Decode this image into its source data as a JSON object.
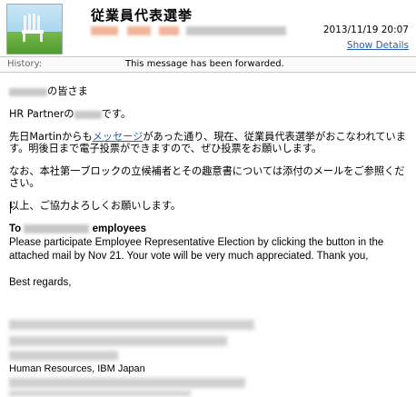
{
  "header": {
    "subject": "従業員代表選挙",
    "date": "2013/11/19 20:07",
    "show_details": "Show Details"
  },
  "history": {
    "label": "History:",
    "text": "This message has been forwarded."
  },
  "body_jp": {
    "greeting_suffix": "の皆さま",
    "intro_prefix": "HR Partnerの",
    "intro_suffix": "です。",
    "para1_before": "先日Martinからも",
    "para1_link": "メッセージ",
    "para1_after": "があった通り、現在、従業員代表選挙がおこなわれています。明後日まで電子投票ができますので、ぜひ投票をお願いします。",
    "para2": "なお、本社第一ブロックの立候補者とその趣意書については添付のメールをご参照ください。",
    "closing": "以上、ご協力よろしくお願いします。"
  },
  "body_en": {
    "to_prefix": "To",
    "to_suffix": "employees",
    "message": "Please participate Employee Representative Election by clicking the button in the attached mail by Nov 21. Your vote will be very much appreciated. Thank you,",
    "regards": "Best regards,",
    "signature_org": "Human Resources, IBM Japan"
  }
}
